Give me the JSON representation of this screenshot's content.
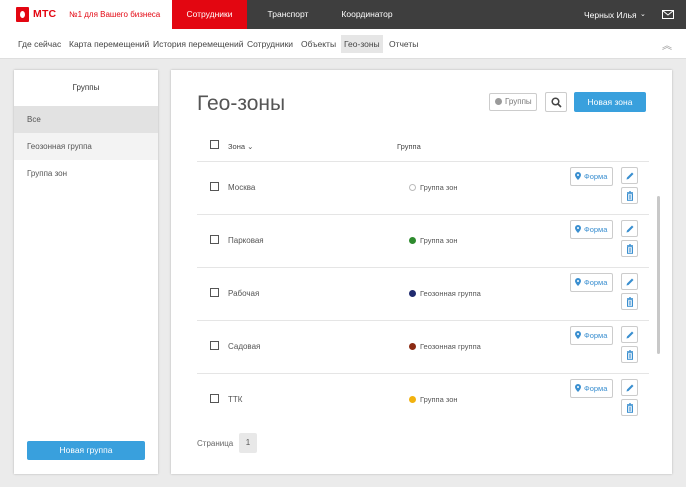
{
  "brand": {
    "name": "МТС",
    "slogan": "№1 для Вашего бизнеса"
  },
  "top_nav": {
    "tabs": [
      {
        "label": "Сотрудники",
        "active": true
      },
      {
        "label": "Транспорт",
        "active": false
      },
      {
        "label": "Координатор",
        "active": false
      }
    ],
    "user_name": "Черных Илья",
    "user_chevron": "⌄",
    "mail_icon": "mail-icon"
  },
  "sub_nav": {
    "items": [
      {
        "label": "Где сейчас"
      },
      {
        "label": "Карта перемещений"
      },
      {
        "label": "История перемещений"
      },
      {
        "label": "Сотрудники"
      },
      {
        "label": "Объекты"
      },
      {
        "label": "Гео-зоны",
        "active": true
      },
      {
        "label": "Отчеты"
      }
    ],
    "collapse_icon": "︽"
  },
  "groups_panel": {
    "title": "Группы",
    "items": [
      {
        "label": "Все",
        "selected": true
      },
      {
        "label": "Геозонная группа"
      },
      {
        "label": "Группа зон"
      }
    ],
    "new_group_button": "Новая группа"
  },
  "main": {
    "title": "Гео-зоны",
    "groups_filter_label": "Группы",
    "new_zone_button": "Новая зона",
    "table": {
      "col_zone": "Зона",
      "col_group": "Группа",
      "rows": [
        {
          "zone": "Москва",
          "group": "Группа зон",
          "group_color": "",
          "form_label": "Форма"
        },
        {
          "zone": "Парковая",
          "group": "Группа зон",
          "group_color": "#2e8b2e",
          "form_label": "Форма"
        },
        {
          "zone": "Рабочая",
          "group": "Геозонная группа",
          "group_color": "#1f2a6e",
          "form_label": "Форма"
        },
        {
          "zone": "Садовая",
          "group": "Геозонная группа",
          "group_color": "#8b2a12",
          "form_label": "Форма"
        },
        {
          "zone": "ТТК",
          "group": "Группа зон",
          "group_color": "#f2b20f",
          "form_label": "Форма"
        }
      ]
    },
    "pagination": {
      "label": "Страница",
      "current": "1"
    }
  },
  "colors": {
    "brand_red": "#e30611",
    "accent_blue": "#39a0dd",
    "topbar_bg": "#3e3e3e"
  }
}
